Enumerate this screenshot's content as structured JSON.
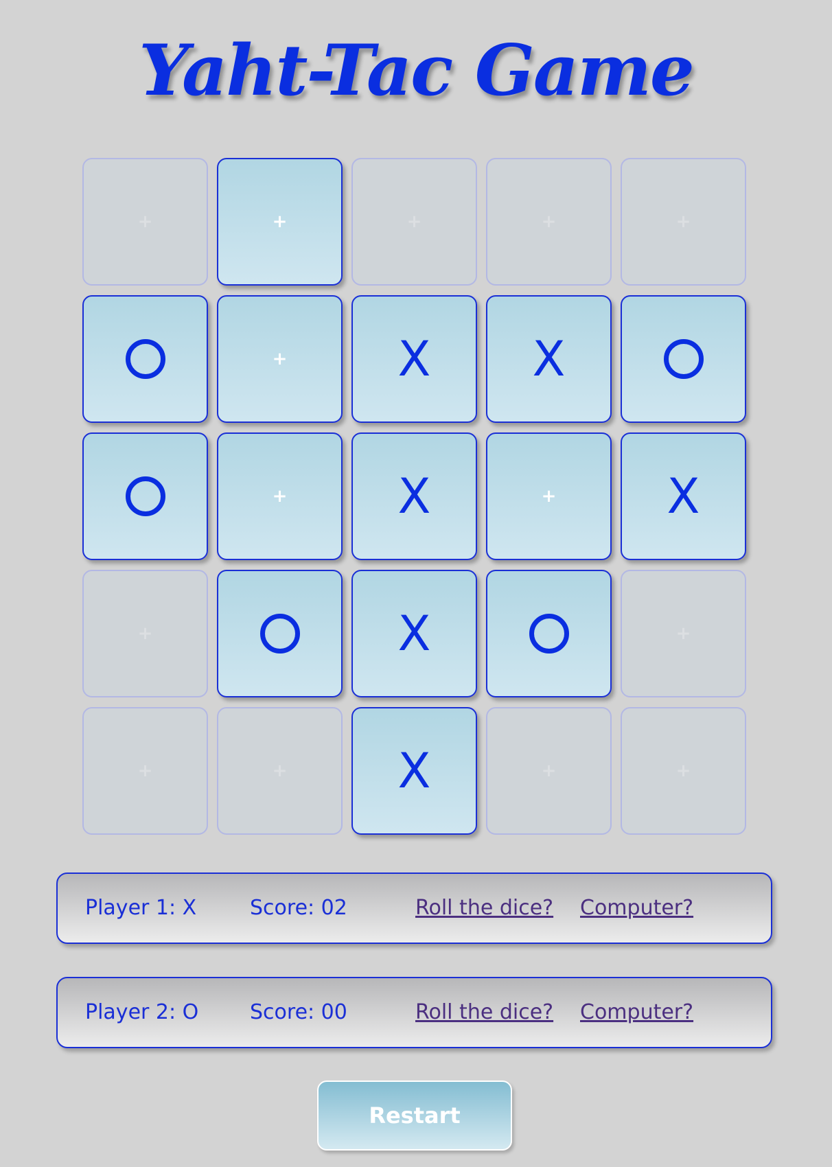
{
  "title": "Yaht-Tac Game",
  "empty_glyph": "+",
  "board": [
    [
      {
        "mark": "",
        "active": false
      },
      {
        "mark": "",
        "active": true
      },
      {
        "mark": "",
        "active": false
      },
      {
        "mark": "",
        "active": false
      },
      {
        "mark": "",
        "active": false
      }
    ],
    [
      {
        "mark": "O",
        "active": true
      },
      {
        "mark": "",
        "active": true
      },
      {
        "mark": "X",
        "active": true
      },
      {
        "mark": "X",
        "active": true
      },
      {
        "mark": "O",
        "active": true
      }
    ],
    [
      {
        "mark": "O",
        "active": true
      },
      {
        "mark": "",
        "active": true
      },
      {
        "mark": "X",
        "active": true
      },
      {
        "mark": "",
        "active": true
      },
      {
        "mark": "X",
        "active": true
      }
    ],
    [
      {
        "mark": "",
        "active": false
      },
      {
        "mark": "O",
        "active": true
      },
      {
        "mark": "X",
        "active": true
      },
      {
        "mark": "O",
        "active": true
      },
      {
        "mark": "",
        "active": false
      }
    ],
    [
      {
        "mark": "",
        "active": false
      },
      {
        "mark": "",
        "active": false
      },
      {
        "mark": "X",
        "active": true
      },
      {
        "mark": "",
        "active": false
      },
      {
        "mark": "",
        "active": false
      }
    ]
  ],
  "players": [
    {
      "label": "Player 1: X",
      "score": "Score: 02",
      "roll": "Roll the dice?",
      "computer": "Computer?"
    },
    {
      "label": "Player 2: O",
      "score": "Score: 00",
      "roll": "Roll the dice?",
      "computer": "Computer?"
    }
  ],
  "restart_label": "Restart",
  "colors": {
    "background": "#d3d3d3",
    "accent": "#0a2ee0",
    "link": "#4b2f80"
  }
}
